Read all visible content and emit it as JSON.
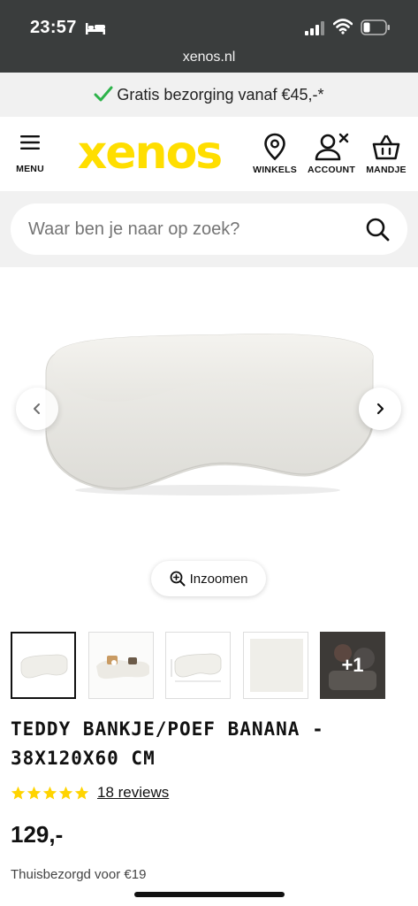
{
  "status_bar": {
    "time": "23:57",
    "url": "xenos.nl"
  },
  "promo": {
    "text": "Gratis bezorging vanaf €45,-*",
    "check_color": "#2db34a"
  },
  "header": {
    "menu_label": "MENU",
    "logo_text": "xenos",
    "logo_color": "#ffde00",
    "winkels_label": "WINKELS",
    "account_label": "ACCOUNT",
    "mandje_label": "MANDJE"
  },
  "search": {
    "placeholder": "Waar ben je naar op zoek?"
  },
  "gallery": {
    "zoom_label": "Inzoomen",
    "thumbnails": [
      {
        "name": "thumb-front-view",
        "active": true
      },
      {
        "name": "thumb-styled-view",
        "active": false
      },
      {
        "name": "thumb-dimensions-view",
        "active": false
      },
      {
        "name": "thumb-fabric-detail",
        "active": false
      },
      {
        "name": "thumb-more",
        "active": false,
        "overlay": "+1"
      }
    ]
  },
  "product": {
    "title": "TEDDY BANKJE/POEF BANANA - 38X120X60 CM",
    "rating_stars": 5,
    "star_color": "#ffd400",
    "reviews": "18 reviews",
    "price": "129,-",
    "delivery": "Thuisbezorgd voor €19"
  }
}
